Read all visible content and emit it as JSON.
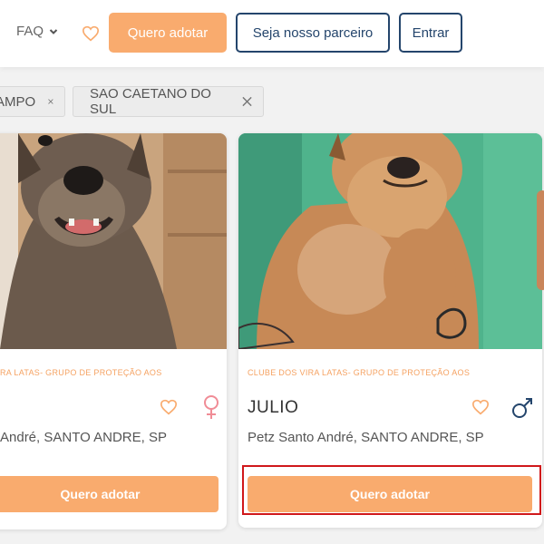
{
  "header": {
    "faq_label": "FAQ",
    "adopt_button": "Quero adotar",
    "partner_button": "Seja nosso parceiro",
    "login_button": "Entrar"
  },
  "filters": [
    {
      "label": "AMPO"
    },
    {
      "label": "SAO CAETANO DO SUL"
    }
  ],
  "cards": [
    {
      "org": "RA LATAS- GRUPO DE PROTEÇÃO AOS",
      "name": "",
      "location": "André, SANTO ANDRE, SP",
      "gender": "female",
      "button": "Quero adotar"
    },
    {
      "org": "CLUBE DOS VIRA LATAS- GRUPO DE PROTEÇÃO AOS",
      "name": "JULIO",
      "location": "Petz Santo André, SANTO ANDRE, SP",
      "gender": "male",
      "button": "Quero adotar"
    }
  ],
  "colors": {
    "accent": "#f9ab6e",
    "navy": "#24456c",
    "female": "#f08c96",
    "male": "#24456c",
    "highlight": "#d0181b"
  },
  "icons": {
    "faq": "chevron-down-icon",
    "favorite": "heart-outline-icon",
    "remove_filter": "close-icon",
    "female": "female-symbol-icon",
    "male": "male-symbol-icon"
  }
}
